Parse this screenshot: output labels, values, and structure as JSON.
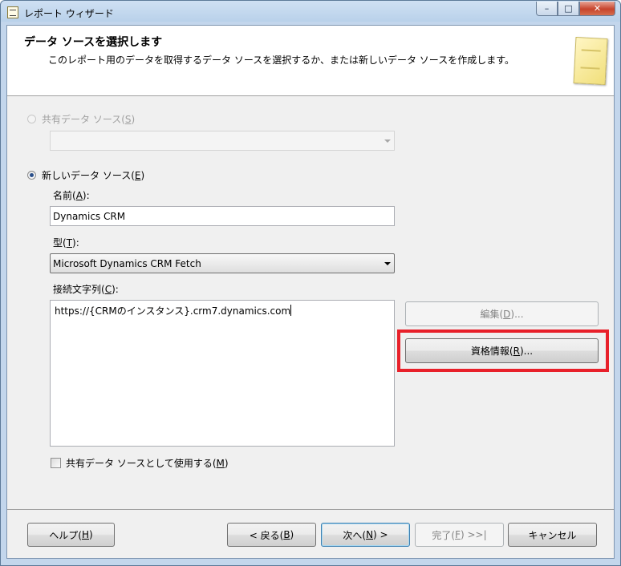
{
  "window": {
    "title": "レポート ウィザード",
    "caption_buttons": {
      "minimize": "–",
      "maximize": "□",
      "close": "✕"
    }
  },
  "header": {
    "title": "データ ソースを選択します",
    "description": "このレポート用のデータを取得するデータ ソースを選択するか、または新しいデータ ソースを作成します。"
  },
  "shared_source": {
    "radio_label_pre": "共有データ ソース(",
    "radio_label_key": "S",
    "radio_label_post": ")",
    "selected": false,
    "enabled": false,
    "combo_value": ""
  },
  "new_source": {
    "radio_label_pre": "新しいデータ ソース(",
    "radio_label_key": "E",
    "radio_label_post": ")",
    "selected": true,
    "name_label_pre": "名前(",
    "name_label_key": "A",
    "name_label_post": "):",
    "name_value": "Dynamics CRM",
    "type_label_pre": "型(",
    "type_label_key": "T",
    "type_label_post": "):",
    "type_value": "Microsoft Dynamics CRM Fetch",
    "conn_label_pre": "接続文字列(",
    "conn_label_key": "C",
    "conn_label_post": "):",
    "conn_value": "https://{CRMのインスタンス}.crm7.dynamics.com",
    "edit_button_pre": "編集(",
    "edit_button_key": "D",
    "edit_button_post": ")...",
    "credentials_button_pre": "資格情報(",
    "credentials_button_key": "R",
    "credentials_button_post": ")...",
    "use_shared_pre": "共有データ ソースとして使用する(",
    "use_shared_key": "M",
    "use_shared_post": ")",
    "use_shared_checked": false
  },
  "footer": {
    "help_pre": "ヘルプ(",
    "help_key": "H",
    "help_post": ")",
    "back_pre": "< 戻る(",
    "back_key": "B",
    "back_post": ")",
    "next_pre": "次へ(",
    "next_key": "N",
    "next_post": ") >",
    "finish_pre": "完了(",
    "finish_key": "F",
    "finish_post": ") >>|",
    "cancel": "キャンセル"
  },
  "colors": {
    "highlight": "#e8202a",
    "titlebar": "#b9d1ea",
    "dialog_bg": "#f0f0f0"
  }
}
